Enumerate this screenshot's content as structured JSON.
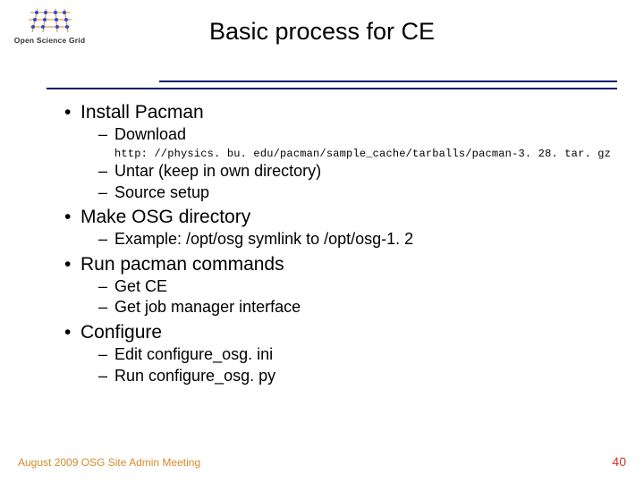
{
  "logo": {
    "text": "Open Science Grid"
  },
  "title": "Basic process for CE",
  "bullets": {
    "b1": {
      "text": "Install Pacman",
      "s1": "Download",
      "url": "http: //physics. bu. edu/pacman/sample_cache/tarballs/pacman-3. 28. tar. gz",
      "s2": "Untar (keep in own directory)",
      "s3": "Source setup"
    },
    "b2": {
      "text": "Make OSG directory",
      "s1": "Example: /opt/osg symlink to /opt/osg-1. 2"
    },
    "b3": {
      "text": "Run pacman commands",
      "s1": "Get CE",
      "s2": "Get job manager interface"
    },
    "b4": {
      "text": "Configure",
      "s1": "Edit configure_osg. ini",
      "s2": "Run configure_osg. py"
    }
  },
  "footer": {
    "left": "August 2009 OSG Site Admin Meeting",
    "right": "40"
  }
}
